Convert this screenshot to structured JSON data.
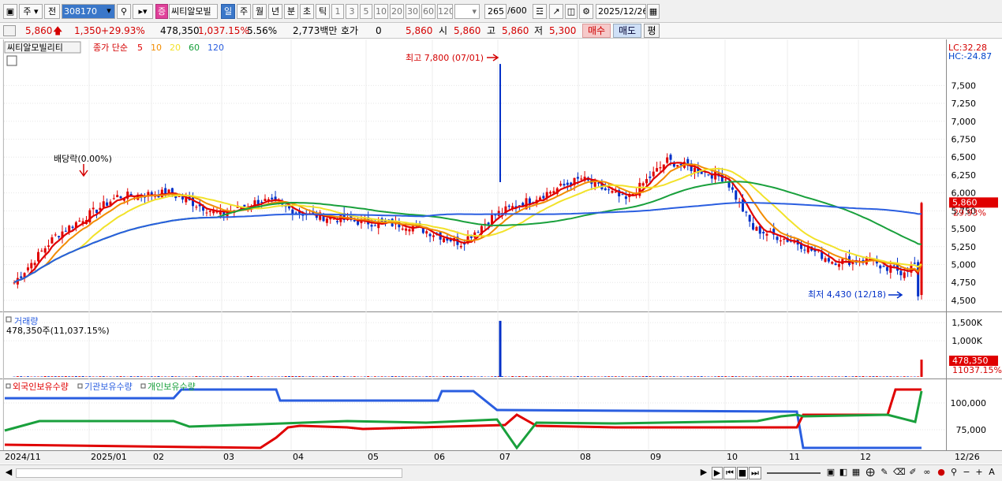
{
  "toolbar": {
    "market_select": "주",
    "prev_label": "전",
    "code": "308170",
    "badge": "증",
    "name": "씨티알모빌",
    "periods": [
      "일",
      "주",
      "월",
      "년",
      "분",
      "초",
      "틱"
    ],
    "active_period": "일",
    "intervals": [
      "1",
      "3",
      "5",
      "10",
      "20",
      "30",
      "60",
      "120"
    ],
    "count": "265",
    "count_max": "/600",
    "date": "2025/12/26"
  },
  "quote": {
    "price": "5,860",
    "change": "1,350",
    "change_pct": "+29.93%",
    "volume": "478,350",
    "volume_pct": "1,037.15%",
    "turnover_pct": "5.56%",
    "amount": "2,773백만",
    "hoga_label": "호가",
    "hoga_value": "0",
    "bid_value": "5,860",
    "open_label": "시",
    "open": "5,860",
    "high_label": "고",
    "high": "5,860",
    "low_label": "저",
    "low": "5,300",
    "buy_button": "매수",
    "sell_button": "매도",
    "eval_button": "평"
  },
  "chart_data": [
    {
      "type": "candlestick",
      "stock_label": "씨티알모빌리티",
      "ma_title": "종가 단순",
      "ma_periods": [
        "5",
        "10",
        "20",
        "60",
        "120"
      ],
      "ma_colors": [
        "#e00000",
        "#f28c00",
        "#f2e22a",
        "#19a03c",
        "#2a5ee0"
      ],
      "lc": "LC:32.28",
      "hc": "HC:-24.87",
      "y_ticks": [
        "7,500",
        "7,250",
        "7,000",
        "6,750",
        "6,500",
        "6,250",
        "6,000",
        "5,750",
        "5,500",
        "5,250",
        "5,000",
        "4,750",
        "4,500"
      ],
      "ylim": [
        4400,
        7900
      ],
      "current_price": "5,860",
      "current_pct": "29.93%",
      "max_annotation": "최고 7,800 (07/01)",
      "min_annotation": "최저 4,430 (12/18)",
      "dividend_annotation": "배당락(0.00%)",
      "close_series": [
        {
          "date": "2024/11",
          "close": 4750
        },
        {
          "date": "2024/11 mid",
          "close": 5400
        },
        {
          "date": "2024/12",
          "close": 5950
        },
        {
          "date": "2025/01",
          "close": 6000
        },
        {
          "date": "2025/01 late",
          "close": 5700
        },
        {
          "date": "02",
          "close": 5900
        },
        {
          "date": "02 mid",
          "close": 5700
        },
        {
          "date": "03",
          "close": 5600
        },
        {
          "date": "03 mid",
          "close": 5550
        },
        {
          "date": "04",
          "close": 5300
        },
        {
          "date": "04 mid",
          "close": 5700
        },
        {
          "date": "05",
          "close": 6000
        },
        {
          "date": "05 mid",
          "close": 6200
        },
        {
          "date": "06",
          "close": 5900
        },
        {
          "date": "06 mid",
          "close": 6450
        },
        {
          "date": "06 late",
          "close": 6300
        },
        {
          "date": "07/01",
          "close": 6200
        },
        {
          "date": "07 mid",
          "close": 5500
        },
        {
          "date": "08",
          "close": 5300
        },
        {
          "date": "08 mid",
          "close": 5050
        },
        {
          "date": "09",
          "close": 5050
        },
        {
          "date": "09 mid",
          "close": 5100
        },
        {
          "date": "10",
          "close": 4900
        },
        {
          "date": "10 mid",
          "close": 4950
        },
        {
          "date": "11",
          "close": 4900
        },
        {
          "date": "11 mid",
          "close": 4950
        },
        {
          "date": "12",
          "close": 5000
        },
        {
          "date": "12/18",
          "close": 4500
        },
        {
          "date": "12/26",
          "close": 5860
        }
      ]
    },
    {
      "type": "bar",
      "title": "거래량",
      "subtitle": "478,350주(11,037.15%)",
      "y_ticks": [
        "1,500K",
        "1,000K"
      ],
      "ylim": [
        0,
        1700000
      ],
      "current_value": "478,350",
      "current_pct": "11037.15%",
      "spikes": [
        {
          "date": "07/01",
          "value": 1550000
        },
        {
          "date": "12/26",
          "value": 478350
        }
      ]
    },
    {
      "type": "line",
      "series": [
        {
          "name": "외국인보유수량",
          "color": "#e00000"
        },
        {
          "name": "기관보유수량",
          "color": "#2a5ee0"
        },
        {
          "name": "개인보유수량",
          "color": "#19a03c"
        }
      ],
      "y_ticks": [
        "100,000",
        "75,000"
      ]
    }
  ],
  "x_axis": [
    "2024/11",
    "2025/01",
    "02",
    "03",
    "04",
    "05",
    "06",
    "07",
    "08",
    "09",
    "10",
    "11",
    "12",
    "12/26"
  ]
}
